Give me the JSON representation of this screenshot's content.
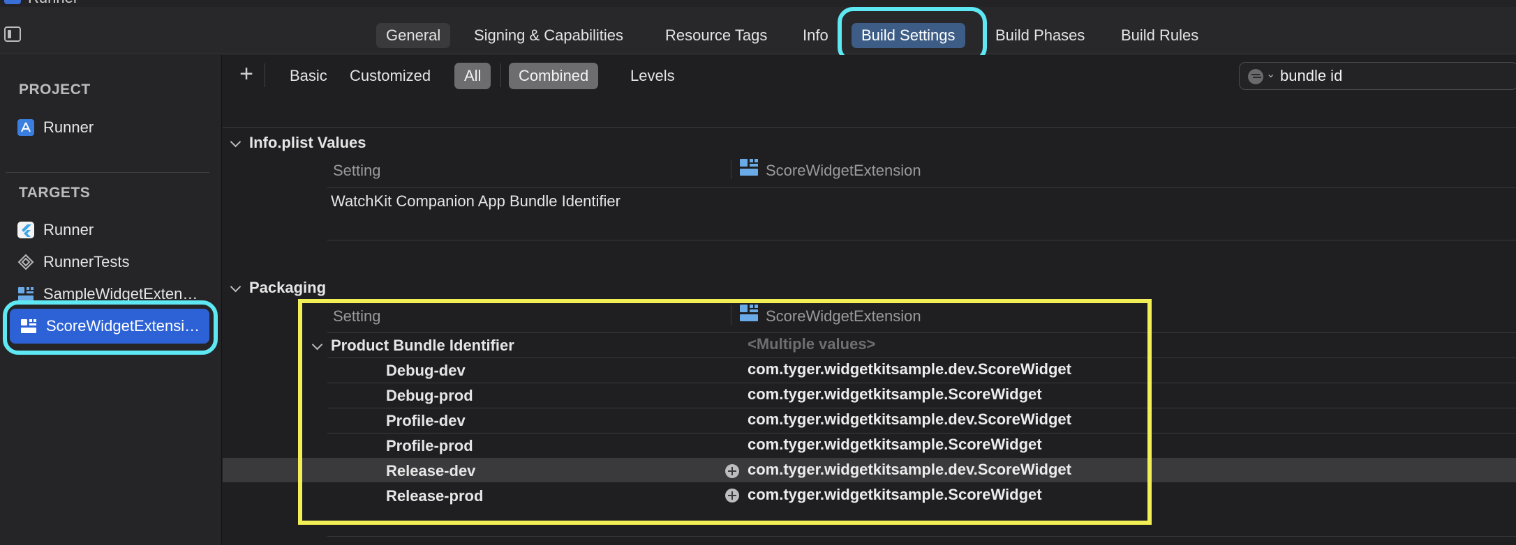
{
  "window": {
    "title": "Runner"
  },
  "tabs": [
    {
      "label": "General"
    },
    {
      "label": "Signing & Capabilities"
    },
    {
      "label": "Resource Tags"
    },
    {
      "label": "Info"
    },
    {
      "label": "Build Settings",
      "selected": true
    },
    {
      "label": "Build Phases"
    },
    {
      "label": "Build Rules"
    }
  ],
  "sidebar": {
    "project_header": "PROJECT",
    "project_items": [
      {
        "label": "Runner",
        "icon": "xcode-project-icon"
      }
    ],
    "targets_header": "TARGETS",
    "target_items": [
      {
        "label": "Runner",
        "icon": "flutter-app-icon"
      },
      {
        "label": "RunnerTests",
        "icon": "test-bundle-icon"
      },
      {
        "label": "SampleWidgetExten…",
        "icon": "widget-extension-icon"
      },
      {
        "label": "ScoreWidgetExtensi…",
        "icon": "widget-extension-icon",
        "selected": true
      }
    ]
  },
  "filter_bar": {
    "add_label": "+",
    "basic": "Basic",
    "customized": "Customized",
    "all": "All",
    "combined": "Combined",
    "levels": "Levels",
    "search_value": "bundle id"
  },
  "groups": {
    "info_plist": {
      "title": "Info.plist Values",
      "setting_col": "Setting",
      "target_col": "ScoreWidgetExtension",
      "rows": [
        {
          "name": "WatchKit Companion App Bundle Identifier",
          "value": ""
        }
      ]
    },
    "packaging": {
      "title": "Packaging",
      "setting_col": "Setting",
      "target_col": "ScoreWidgetExtension",
      "parent_row": {
        "name": "Product Bundle Identifier",
        "value": "<Multiple values>"
      },
      "rows": [
        {
          "name": "Debug-dev",
          "value": "com.tyger.widgetkitsample.dev.ScoreWidget"
        },
        {
          "name": "Debug-prod",
          "value": "com.tyger.widgetkitsample.ScoreWidget"
        },
        {
          "name": "Profile-dev",
          "value": "com.tyger.widgetkitsample.dev.ScoreWidget"
        },
        {
          "name": "Profile-prod",
          "value": "com.tyger.widgetkitsample.ScoreWidget"
        },
        {
          "name": "Release-dev",
          "value": "com.tyger.widgetkitsample.dev.ScoreWidget"
        },
        {
          "name": "Release-prod",
          "value": "com.tyger.widgetkitsample.ScoreWidget"
        }
      ]
    }
  },
  "colors": {
    "highlight_cyan": "#5ee8f3",
    "highlight_yellow": "#f2ef56",
    "selection_blue": "#2d62d6",
    "tab_selected": "#3d5d86"
  }
}
